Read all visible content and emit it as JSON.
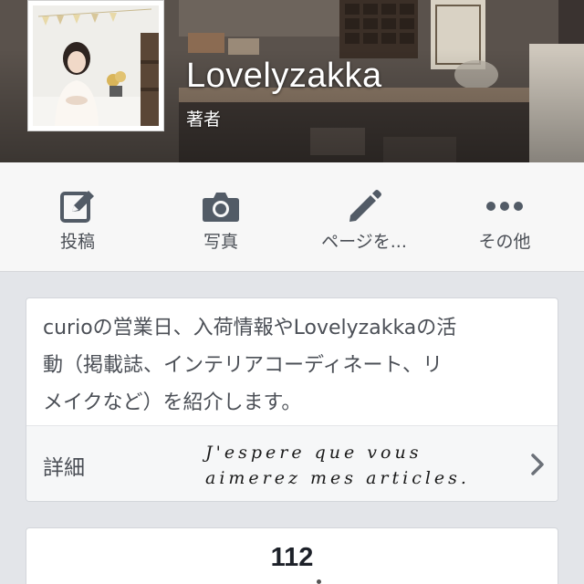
{
  "header": {
    "page_name": "Lovelyzakka",
    "category": "著者"
  },
  "actions": [
    {
      "label": "投稿",
      "icon": "compose-icon"
    },
    {
      "label": "写真",
      "icon": "camera-icon"
    },
    {
      "label": "ページを...",
      "icon": "pencil-icon"
    },
    {
      "label": "その他",
      "icon": "more-dots-icon"
    }
  ],
  "about": {
    "lines": [
      "curioの営業日、入荷情報やLovelyzakkaの活",
      "動（掲載誌、インテリアコーディネート、リ",
      "メイクなど）を紹介します。"
    ],
    "details_label": "詳細",
    "script_line1": "J'espere que vous",
    "script_line2": "aimerez mes articles."
  },
  "stats": {
    "value": "112"
  },
  "colors": {
    "action_icon": "#525b66",
    "text": "#4b4f56",
    "background": "#e3e5e9"
  }
}
